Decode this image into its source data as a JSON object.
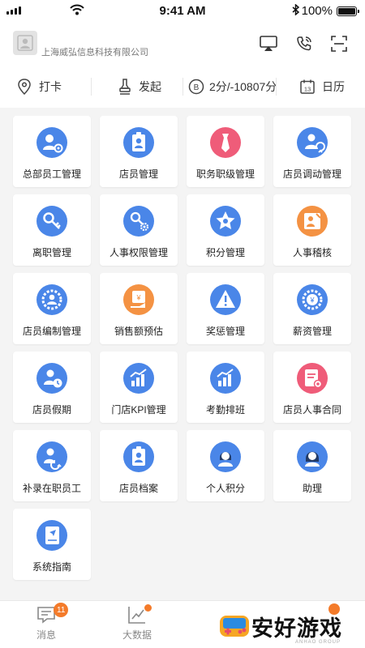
{
  "status_bar": {
    "time": "9:41 AM",
    "battery": "100%",
    "battery_level": 1.0
  },
  "header": {
    "company": "上海威弘信息科技有限公司"
  },
  "quickbar": {
    "checkin": "打卡",
    "initiate": "发起",
    "points": "2分/-10807分",
    "calendar": "日历"
  },
  "grid": [
    {
      "label": "总部员工管理",
      "icon": "hq-staff-icon",
      "color": "#4a86e8"
    },
    {
      "label": "店员管理",
      "icon": "staff-badge-icon",
      "color": "#4a86e8"
    },
    {
      "label": "职务职级管理",
      "icon": "tie-icon",
      "color": "#ef5c79"
    },
    {
      "label": "店员调动管理",
      "icon": "transfer-icon",
      "color": "#4a86e8"
    },
    {
      "label": "离职管理",
      "icon": "key-icon",
      "color": "#4a86e8"
    },
    {
      "label": "人事权限管理",
      "icon": "key-gear-icon",
      "color": "#4a86e8"
    },
    {
      "label": "积分管理",
      "icon": "star-icon",
      "color": "#4a86e8"
    },
    {
      "label": "人事稽核",
      "icon": "audit-icon",
      "color": "#f49243"
    },
    {
      "label": "店员编制管理",
      "icon": "staffing-gear-icon",
      "color": "#4a86e8"
    },
    {
      "label": "销售额预估",
      "icon": "sales-estimate-icon",
      "color": "#f49243"
    },
    {
      "label": "奖惩管理",
      "icon": "warning-icon",
      "color": "#4a86e8"
    },
    {
      "label": "薪资管理",
      "icon": "salary-gear-icon",
      "color": "#4a86e8"
    },
    {
      "label": "店员假期",
      "icon": "leave-clock-icon",
      "color": "#4a86e8"
    },
    {
      "label": "门店KPI管理",
      "icon": "kpi-chart-icon",
      "color": "#4a86e8"
    },
    {
      "label": "考勤排班",
      "icon": "attendance-chart-icon",
      "color": "#4a86e8"
    },
    {
      "label": "店员人事合同",
      "icon": "contract-icon",
      "color": "#ef5c79"
    },
    {
      "label": "补录在职员工",
      "icon": "add-employee-icon",
      "color": "#4a86e8"
    },
    {
      "label": "店员档案",
      "icon": "archive-icon",
      "color": "#4a86e8"
    },
    {
      "label": "个人积分",
      "icon": "person-icon",
      "color": "#4a86e8"
    },
    {
      "label": "助理",
      "icon": "assistant-icon",
      "color": "#4a86e8"
    },
    {
      "label": "系统指南",
      "icon": "guide-book-icon",
      "color": "#4a86e8"
    }
  ],
  "tabbar": {
    "messages": "消息",
    "messages_badge": "11",
    "bigdata": "大数据"
  },
  "watermark": {
    "text": "安好游戏",
    "sub": "ANHAO GROUP"
  }
}
